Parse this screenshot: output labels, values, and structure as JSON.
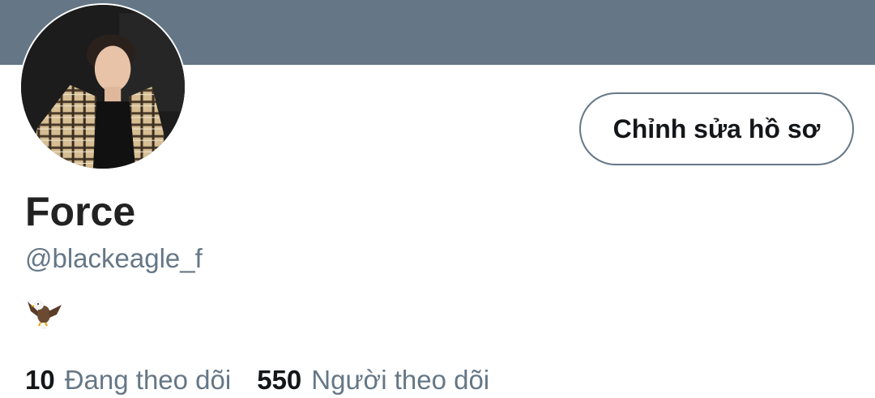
{
  "profile": {
    "display_name": "Force",
    "handle": "@blackeagle_f",
    "bio_icon": "eagle-emoji",
    "edit_label": "Chỉnh sửa hồ sơ"
  },
  "stats": {
    "following_count": "10",
    "following_label": "Đang theo dõi",
    "followers_count": "550",
    "followers_label": "Người theo dõi"
  },
  "colors": {
    "banner": "#657786",
    "secondary_text": "#657786",
    "primary_text": "#14171a",
    "background": "#ffffff"
  }
}
